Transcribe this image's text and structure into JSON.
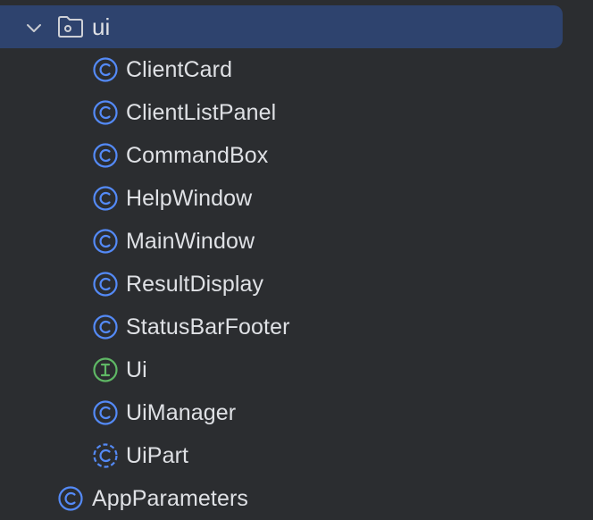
{
  "project_tree": {
    "folder": {
      "label": "ui",
      "expanded": true,
      "icon": "folder-package-icon",
      "selected_color": "#2e436e"
    },
    "items": [
      {
        "label": "ClientCard",
        "kind": "class",
        "icon": "class-icon"
      },
      {
        "label": "ClientListPanel",
        "kind": "class",
        "icon": "class-icon"
      },
      {
        "label": "CommandBox",
        "kind": "class",
        "icon": "class-icon"
      },
      {
        "label": "HelpWindow",
        "kind": "class",
        "icon": "class-icon"
      },
      {
        "label": "MainWindow",
        "kind": "class",
        "icon": "class-icon"
      },
      {
        "label": "ResultDisplay",
        "kind": "class",
        "icon": "class-icon"
      },
      {
        "label": "StatusBarFooter",
        "kind": "class",
        "icon": "class-icon"
      },
      {
        "label": "Ui",
        "kind": "interface",
        "icon": "interface-icon"
      },
      {
        "label": "UiManager",
        "kind": "class",
        "icon": "class-icon"
      },
      {
        "label": "UiPart",
        "kind": "abstract-class",
        "icon": "abstract-class-icon"
      }
    ],
    "next_sibling": {
      "label": "AppParameters",
      "kind": "class",
      "icon": "class-icon"
    }
  },
  "colors": {
    "background": "#2b2d30",
    "text": "#dfe1e5",
    "class_icon": "#548af7",
    "interface_icon": "#5fb865"
  }
}
